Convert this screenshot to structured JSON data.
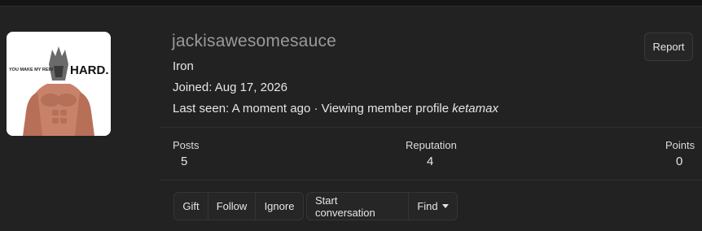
{
  "profile": {
    "username": "jackisawesomesauce",
    "rank": "Iron",
    "joined_label": "Joined:",
    "joined_date": "Aug 17, 2026",
    "last_seen_label": "Last seen:",
    "last_seen_value": "A moment ago",
    "separator": "·",
    "activity_text": "Viewing member profile",
    "activity_target": "ketamax",
    "avatar_text_1": "YOU MAKE MY REIN",
    "avatar_text_2": "HARD."
  },
  "actions": {
    "report_label": "Report"
  },
  "stats": [
    {
      "label": "Posts",
      "value": "5"
    },
    {
      "label": "Reputation",
      "value": "4"
    },
    {
      "label": "Points",
      "value": "0"
    }
  ],
  "buttons": {
    "group1": [
      "Gift",
      "Follow",
      "Ignore"
    ],
    "group2": [
      "Start conversation",
      "Find"
    ]
  },
  "colors": {
    "background": "#222222",
    "username": "#9a9a9a",
    "text": "#e6e6e6"
  }
}
